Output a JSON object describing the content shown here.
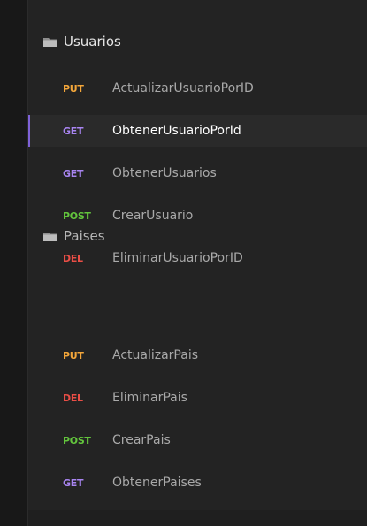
{
  "folders": [
    {
      "label": "Usuarios",
      "items": [
        {
          "method": "PUT",
          "label": "ActualizarUsuarioPorID",
          "method_color": "#f3a63a"
        },
        {
          "method": "GET",
          "label": "ObtenerUsuarioPorId",
          "method_color": "#a985f2",
          "selected": true
        },
        {
          "method": "GET",
          "label": "ObtenerUsuarios",
          "method_color": "#a985f2"
        },
        {
          "method": "POST",
          "label": "CrearUsuario",
          "method_color": "#63c53d"
        },
        {
          "method": "DEL",
          "label": "EliminarUsuarioPorID",
          "method_color": "#ea4e46"
        }
      ]
    },
    {
      "label": "Paises",
      "items": [
        {
          "method": "PUT",
          "label": "ActualizarPais",
          "method_color": "#f3a63a"
        },
        {
          "method": "DEL",
          "label": "EliminarPais",
          "method_color": "#ea4e46"
        },
        {
          "method": "POST",
          "label": "CrearPais",
          "method_color": "#63c53d"
        },
        {
          "method": "GET",
          "label": "ObtenerPaises",
          "method_color": "#a985f2"
        }
      ]
    }
  ],
  "colors": {
    "background": "#1e1e1e",
    "sidebar": "#232323",
    "selected_background": "#2a2a2a",
    "selected_border": "#7f62d8"
  },
  "icons": {
    "folder": "folder-open-icon"
  }
}
